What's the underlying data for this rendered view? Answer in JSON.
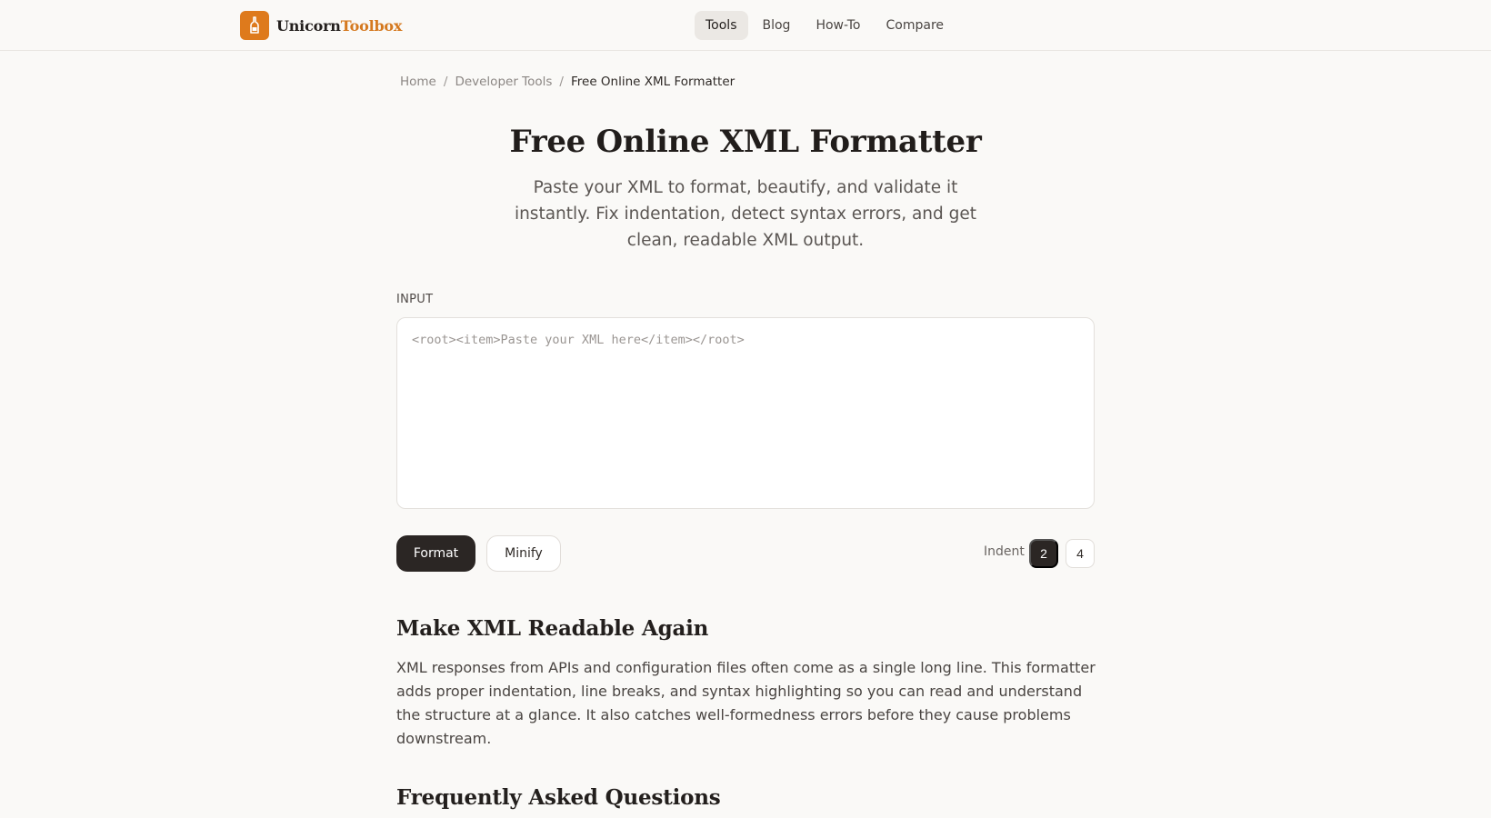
{
  "brand": {
    "name_primary": "Unicorn",
    "name_accent": "Toolbox",
    "logo_icon": "bottle-icon",
    "accent_color": "#de7a1c"
  },
  "nav": {
    "items": [
      {
        "label": "Tools",
        "active": true
      },
      {
        "label": "Blog",
        "active": false
      },
      {
        "label": "How-To",
        "active": false
      },
      {
        "label": "Compare",
        "active": false
      }
    ]
  },
  "breadcrumb": {
    "items": [
      "Home",
      "Developer Tools",
      "Free Online XML Formatter"
    ],
    "separator": "/"
  },
  "hero": {
    "title": "Free Online XML Formatter",
    "subtitle": "Paste your XML to format, beautify, and validate it instantly. Fix indentation, detect syntax errors, and get clean, readable XML output."
  },
  "editor": {
    "label": "INPUT",
    "value": "",
    "placeholder": "<root><item>Paste your XML here</item></root>"
  },
  "actions": {
    "format_label": "Format",
    "minify_label": "Minify",
    "indent_label": "Indent",
    "indent_options": [
      "2",
      "4"
    ],
    "indent_selected": "2"
  },
  "content": {
    "section_title": "Make XML Readable Again",
    "section_body": "XML responses from APIs and configuration files often come as a single long line. This formatter adds proper indentation, line breaks, and syntax highlighting so you can read and understand the structure at a glance. It also catches well-formedness errors before they cause problems downstream.",
    "faq_title": "Frequently Asked Questions"
  }
}
